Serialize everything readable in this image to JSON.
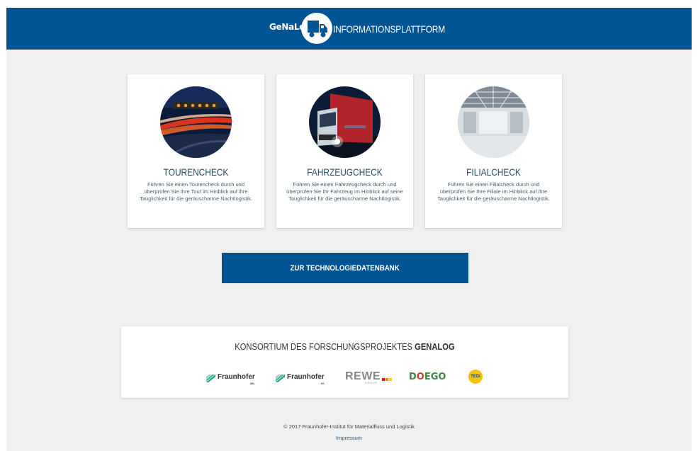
{
  "header": {
    "logo_text": "GeNaLog",
    "title": "INFORMATIONSPLATTFORM",
    "bg_color": "#005494"
  },
  "cards": [
    {
      "title": "TOURENCHECK",
      "text": "Führen Sie einen Tourencheck durch und überprüfen Sie Ihre Tour im Hinblick auf ihre Tauglichkeit für die geräuscharme Nachtlogistik.",
      "image": "highway-night-image"
    },
    {
      "title": "FAHRZEUGCHECK",
      "text": "Führen Sie einen Fahrzeugcheck durch und überprüfen Sie Ihr Fahrzeug im Hinblick auf seine Tauglichkeit für die geräuscharme Nachtlogistik.",
      "image": "truck-night-image"
    },
    {
      "title": "FILIALCHECK",
      "text": "Führen Sie einen Filialcheck durch und überprüfen Sie Ihre Filiale im Hinblick auf ihre Tauglichkeit für die geräuscharme Nachtlogistik.",
      "image": "warehouse-image"
    }
  ],
  "db_button": "ZUR TECHNOLOGIEDATENBANK",
  "consortium": {
    "title_prefix": "KONSORTIUM DES FORSCHUNGSPROJEKTES ",
    "title_bold": "GENALOG",
    "partners": [
      {
        "name": "Fraunhofer",
        "sub": "IML"
      },
      {
        "name": "Fraunhofer",
        "sub": "IIS"
      },
      {
        "name": "REWE",
        "sub": "GROUP"
      },
      {
        "name": "DOEGO"
      },
      {
        "name": "TEDi"
      }
    ]
  },
  "footer": {
    "copyright": "© 2017 Fraunhofer-Institut für Materialfluss und Logistik",
    "impressum": "Impressum"
  }
}
